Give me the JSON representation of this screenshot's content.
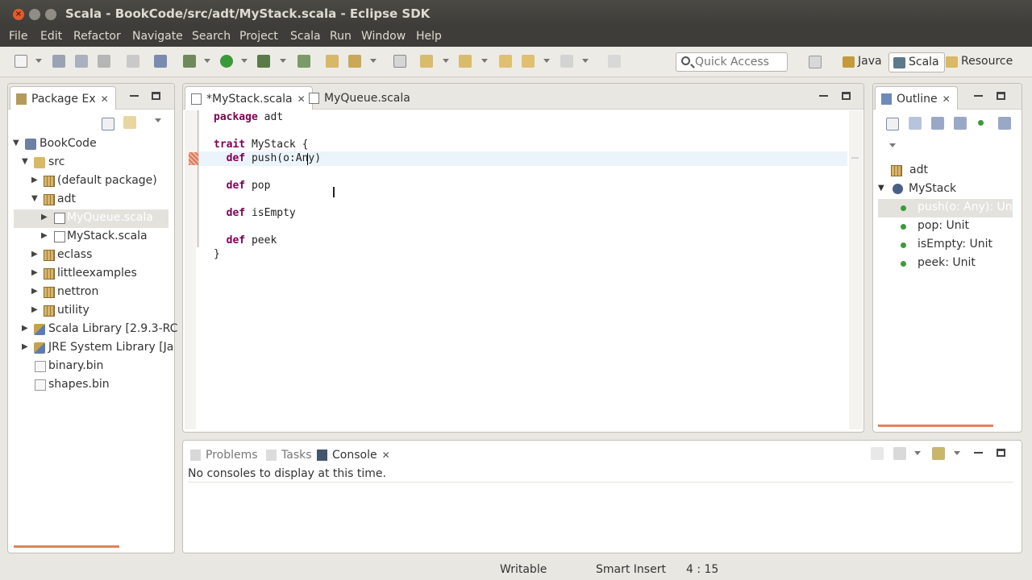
{
  "window": {
    "title": "Scala - BookCode/src/adt/MyStack.scala - Eclipse SDK"
  },
  "menu": [
    "File",
    "Edit",
    "Refactor",
    "Navigate",
    "Search",
    "Project",
    "Scala",
    "Run",
    "Window",
    "Help"
  ],
  "toolbar": {
    "quick_access_placeholder": "Quick Access",
    "perspectives": [
      "Java",
      "Scala",
      "Resource"
    ],
    "active_perspective": "Scala"
  },
  "package_explorer": {
    "tab_label": "Package Ex",
    "tree": [
      {
        "label": "BookCode",
        "icon": "project-icon"
      },
      {
        "label": "src",
        "icon": "source-folder-icon"
      },
      {
        "label": "(default package)",
        "icon": "package-icon"
      },
      {
        "label": "adt",
        "icon": "package-icon"
      },
      {
        "label": "MyQueue.scala",
        "icon": "scala-file-icon",
        "selected": true
      },
      {
        "label": "MyStack.scala",
        "icon": "scala-file-icon"
      },
      {
        "label": "eclass",
        "icon": "package-icon"
      },
      {
        "label": "littleexamples",
        "icon": "package-icon"
      },
      {
        "label": "nettron",
        "icon": "package-icon"
      },
      {
        "label": "utility",
        "icon": "package-icon"
      },
      {
        "label": "Scala Library [2.9.3-RC",
        "icon": "library-icon"
      },
      {
        "label": "JRE System Library [Ja",
        "icon": "library-icon"
      },
      {
        "label": "binary.bin",
        "icon": "file-icon"
      },
      {
        "label": "shapes.bin",
        "icon": "file-icon"
      }
    ]
  },
  "editor": {
    "tabs": [
      {
        "label": "*MyStack.scala",
        "active": true
      },
      {
        "label": "MyQueue.scala",
        "active": false
      }
    ],
    "lines": [
      {
        "kw": "package",
        "rest": " adt"
      },
      {
        "kw": "",
        "rest": ""
      },
      {
        "kw": "trait",
        "rest": " MyStack {"
      },
      {
        "kw": "  def",
        "rest": " push(o:Any)"
      },
      {
        "kw": "",
        "rest": ""
      },
      {
        "kw": "  def",
        "rest": " pop"
      },
      {
        "kw": "",
        "rest": ""
      },
      {
        "kw": "  def",
        "rest": " isEmpty"
      },
      {
        "kw": "",
        "rest": ""
      },
      {
        "kw": "  def",
        "rest": " peek"
      },
      {
        "kw": "",
        "rest": "}"
      }
    ]
  },
  "outline": {
    "tab_label": "Outline",
    "items": [
      {
        "label": "adt",
        "kind": "package"
      },
      {
        "label": "MyStack",
        "kind": "trait"
      },
      {
        "label": "push(o: Any): Unit",
        "kind": "method",
        "selected": true
      },
      {
        "label": "pop: Unit",
        "kind": "method"
      },
      {
        "label": "isEmpty: Unit",
        "kind": "method"
      },
      {
        "label": "peek: Unit",
        "kind": "method"
      }
    ]
  },
  "bottom_panel": {
    "tabs": [
      "Problems",
      "Tasks",
      "Console"
    ],
    "active_tab": "Console",
    "message": "No consoles to display at this time."
  },
  "status": {
    "writable": "Writable",
    "insert_mode": "Smart Insert",
    "position": "4 : 15"
  }
}
